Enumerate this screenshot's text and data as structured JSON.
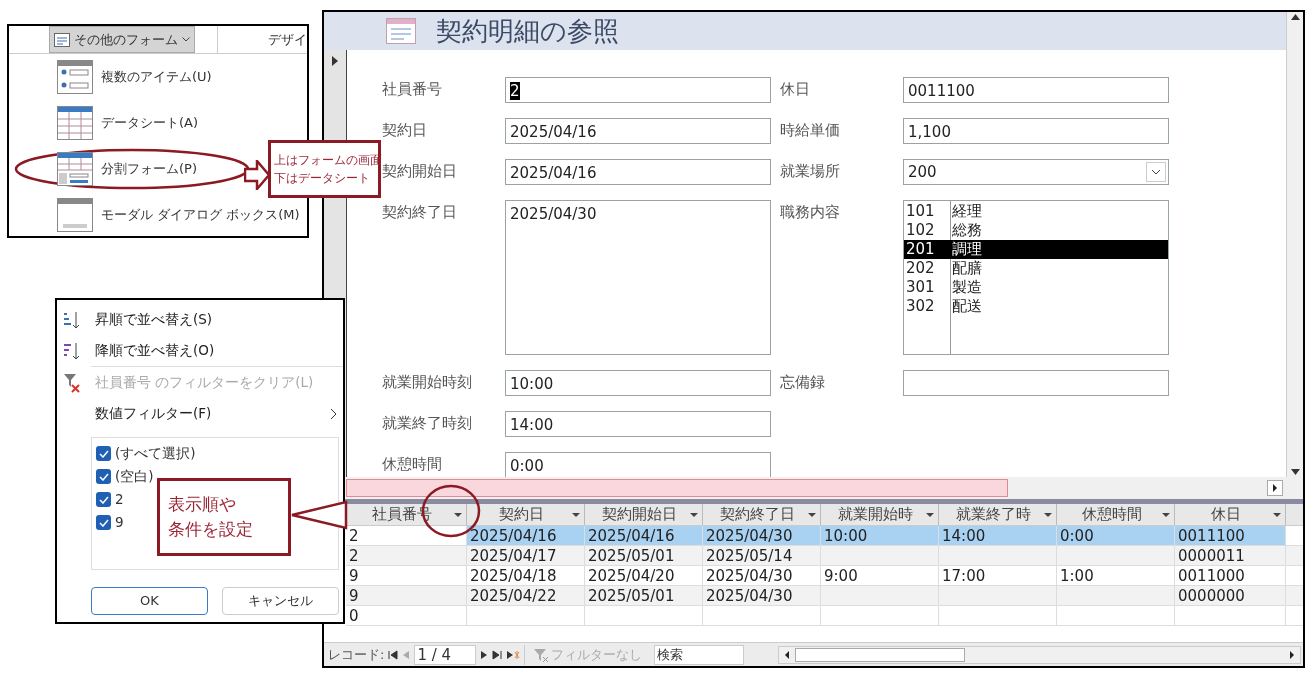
{
  "form_menu": {
    "button": "その他のフォーム",
    "tab_2": "デザイ",
    "items": [
      {
        "label": "複数のアイテム(U)",
        "kind": "multiple",
        "circled": false
      },
      {
        "label": "データシート(A)",
        "kind": "datasheet",
        "circled": false
      },
      {
        "label": "分割フォーム(P)",
        "kind": "split",
        "circled": true
      },
      {
        "label": "モーダル ダイアログ ボックス(M)",
        "kind": "modal",
        "circled": false
      }
    ]
  },
  "callouts": [
    {
      "lines": [
        "上はフォームの画面",
        "下はデータシート"
      ]
    },
    {
      "lines": [
        "表示順や",
        "条件を設定"
      ]
    }
  ],
  "filter_menu": {
    "items": [
      {
        "label": "昇順で並べ替え(S)",
        "kind": "sort-asc",
        "disabled": false
      },
      {
        "label": "降順で並べ替え(O)",
        "kind": "sort-desc",
        "disabled": false
      },
      {
        "label": "社員番号 のフィルターをクリア(L)",
        "kind": "clear-filter",
        "disabled": true
      },
      {
        "label": "数値フィルター(F)",
        "kind": "submenu",
        "disabled": false
      }
    ],
    "values": [
      {
        "label": "(すべて選択)",
        "checked": true
      },
      {
        "label": "(空白)",
        "checked": true
      },
      {
        "label": "2",
        "checked": true
      },
      {
        "label": "9",
        "checked": true
      }
    ],
    "buttons": [
      "OK",
      "キャンセル"
    ]
  },
  "form": {
    "title": "契約明細の参照",
    "left_fields": [
      {
        "label": "社員番号",
        "value": "2",
        "kind": "text",
        "selected": true
      },
      {
        "label": "契約日",
        "value": "2025/04/16",
        "kind": "text"
      },
      {
        "label": "契約開始日",
        "value": "2025/04/16",
        "kind": "text"
      },
      {
        "label": "契約終了日",
        "value": "2025/04/30",
        "kind": "memo"
      },
      {
        "label": "就業開始時刻",
        "value": "10:00",
        "kind": "text"
      },
      {
        "label": "就業終了時刻",
        "value": "14:00",
        "kind": "text"
      },
      {
        "label": "休憩時間",
        "value": "0:00",
        "kind": "text"
      }
    ],
    "right_fields": [
      {
        "label": "休日",
        "value": "0011100",
        "kind": "text"
      },
      {
        "label": "時給単価",
        "value": "1,100",
        "kind": "text"
      },
      {
        "label": "就業場所",
        "value": "200",
        "kind": "combo"
      },
      {
        "label": "職務内容",
        "kind": "list",
        "options": [
          {
            "code": "101",
            "name": "経理",
            "selected": false
          },
          {
            "code": "102",
            "name": "総務",
            "selected": false
          },
          {
            "code": "201",
            "name": "調理",
            "selected": true
          },
          {
            "code": "202",
            "name": "配膳",
            "selected": false
          },
          {
            "code": "301",
            "name": "製造",
            "selected": false
          },
          {
            "code": "302",
            "name": "配送",
            "selected": false
          }
        ]
      },
      {
        "label": "忘備録",
        "kind": "text"
      }
    ]
  },
  "datasheet": {
    "columns": [
      "社員番号",
      "契約日",
      "契約開始日",
      "契約終了日",
      "就業開始時",
      "就業終了時",
      "休憩時間",
      "休日"
    ],
    "rows": [
      {
        "selected": true,
        "cells": [
          "2",
          "2025/04/16",
          "2025/04/16",
          "2025/04/30",
          "10:00",
          "14:00",
          "0:00",
          "0011100"
        ]
      },
      {
        "selected": false,
        "cells": [
          "2",
          "2025/04/17",
          "2025/05/01",
          "2025/05/14",
          "",
          "",
          "",
          "0000011"
        ]
      },
      {
        "selected": false,
        "cells": [
          "9",
          "2025/04/18",
          "2025/04/20",
          "2025/04/30",
          "9:00",
          "17:00",
          "1:00",
          "0011000"
        ]
      },
      {
        "selected": false,
        "cells": [
          "9",
          "2025/04/22",
          "2025/05/01",
          "2025/04/30",
          "",
          "",
          "",
          "0000000"
        ]
      },
      {
        "selected": false,
        "cells": [
          "0",
          "",
          "",
          "",
          "",
          "",
          "",
          ""
        ]
      }
    ]
  },
  "navigation": {
    "label": "レコード:",
    "position": "1 / 4",
    "filter": "フィルターなし",
    "search": "検索"
  }
}
